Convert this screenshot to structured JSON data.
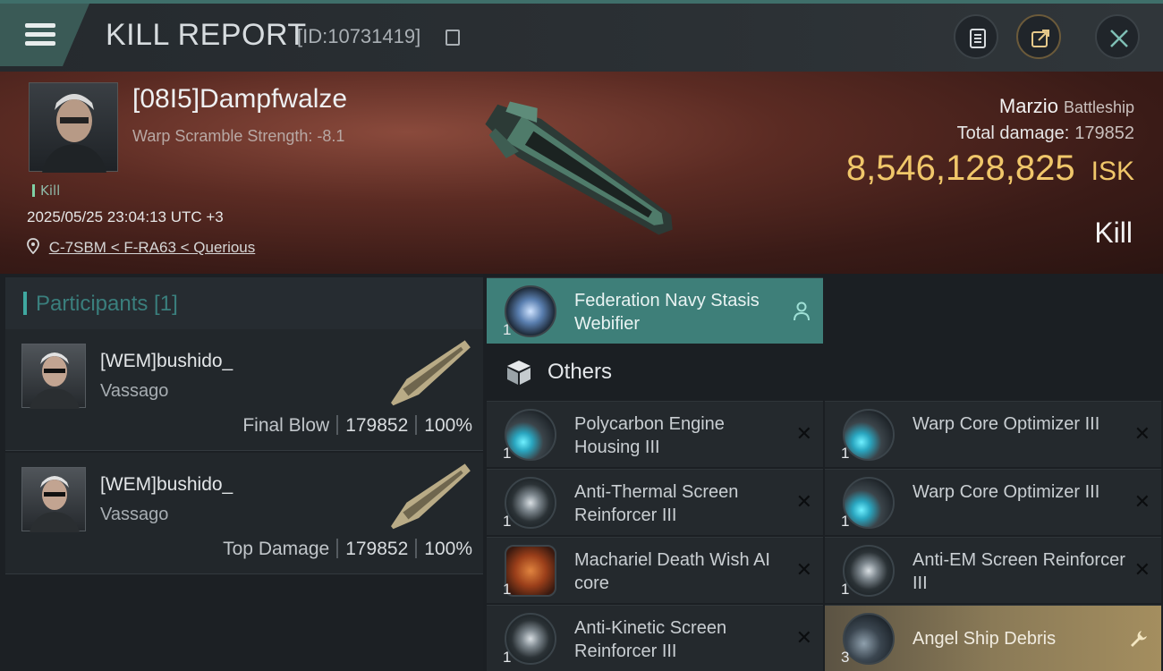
{
  "header": {
    "title": "KILL REPORT",
    "kill_id": "[ID:10731419]",
    "icons": [
      "menu-icon",
      "copy-icon",
      "clipboard-icon",
      "share-icon",
      "close-icon"
    ]
  },
  "victim": {
    "pilot_name": "[08I5]Dampfwalze",
    "warp_scramble": "Warp Scramble Strength: -8.1",
    "kill_tag": "Kill",
    "datetime": "2025/05/25 23:04:13 UTC +3",
    "location": "C-7SBM < F-RA63 < Querious",
    "ship_name": "Marzio",
    "ship_class": "Battleship",
    "total_damage_label": "Total damage:",
    "total_damage": "179852",
    "isk_value": "8,546,128,825",
    "isk_unit": "ISK",
    "result": "Kill"
  },
  "participants": {
    "header": "Participants [1]",
    "rows": [
      {
        "name": "[WEM]bushido_",
        "ship": "Vassago",
        "role": "Final Blow",
        "damage": "179852",
        "percent": "100%"
      },
      {
        "name": "[WEM]bushido_",
        "ship": "Vassago",
        "role": "Top Damage",
        "damage": "179852",
        "percent": "100%"
      }
    ]
  },
  "modules": {
    "highlight": {
      "name": "Federation Navy Stasis Webifier",
      "qty": "1"
    },
    "others_label": "Others",
    "items": [
      {
        "name": "Polycarbon Engine Housing III",
        "qty": "1",
        "state": "destroyed"
      },
      {
        "name": "Warp Core Optimizer III",
        "qty": "1",
        "state": "destroyed"
      },
      {
        "name": "Anti-Thermal Screen Reinforcer III",
        "qty": "1",
        "state": "destroyed"
      },
      {
        "name": "Warp Core Optimizer III",
        "qty": "1",
        "state": "destroyed"
      },
      {
        "name": "Machariel Death Wish AI core",
        "qty": "1",
        "state": "destroyed"
      },
      {
        "name": "Anti-EM Screen Reinforcer III",
        "qty": "1",
        "state": "destroyed"
      },
      {
        "name": "Anti-Kinetic Screen Reinforcer III",
        "qty": "1",
        "state": "destroyed"
      },
      {
        "name": "Angel Ship Debris",
        "qty": "3",
        "state": "dropped"
      }
    ]
  },
  "colors": {
    "accent_teal": "#3e7f79",
    "isk_gold": "#f0c76a",
    "dropped_gold": "#a48e5f"
  }
}
